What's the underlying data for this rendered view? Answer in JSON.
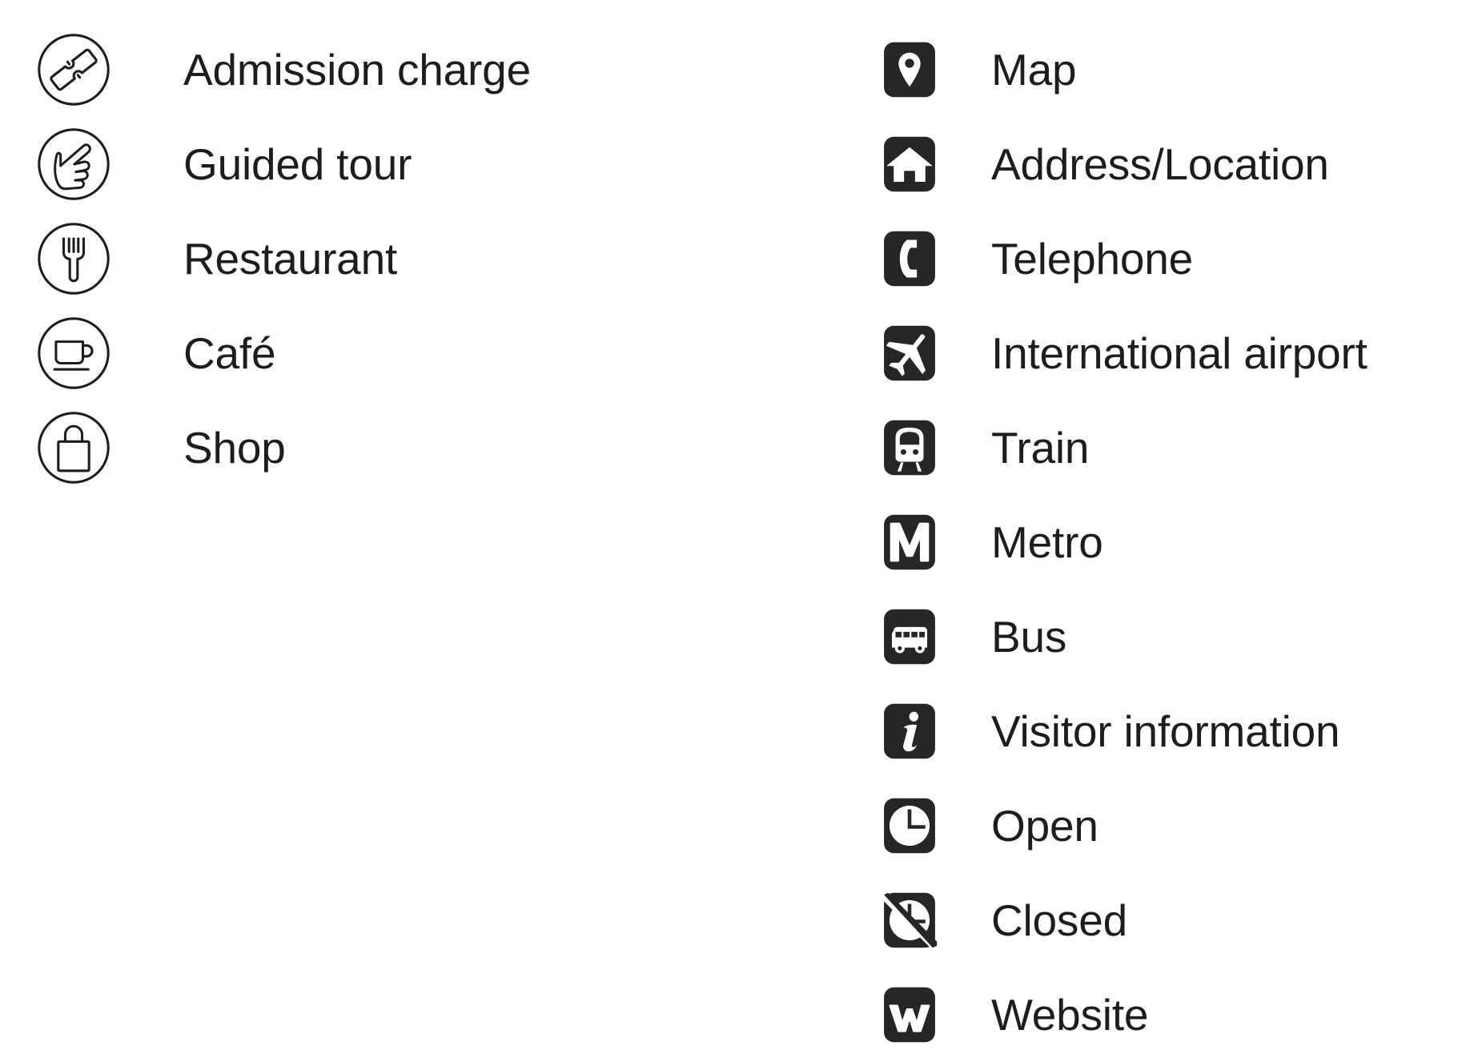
{
  "page": {
    "background_color": "#ffffff",
    "text_color": "#1d1d1b",
    "icon_fill_color": "#262626"
  },
  "legend": {
    "columns": [
      {
        "id": "facilities",
        "icon_style": "outline-circle",
        "items": [
          {
            "label": "Admission charge",
            "icon": "ticket-icon"
          },
          {
            "label": "Guided tour",
            "icon": "pointing-hand-icon"
          },
          {
            "label": "Restaurant",
            "icon": "fork-icon"
          },
          {
            "label": "Café",
            "icon": "coffee-cup-icon"
          },
          {
            "label": "Shop",
            "icon": "shopping-bag-icon"
          }
        ]
      },
      {
        "id": "practical-information",
        "icon_style": "solid-rounded-square",
        "items": [
          {
            "label": "Map",
            "icon": "map-pin-icon"
          },
          {
            "label": "Address/Location",
            "icon": "house-icon"
          },
          {
            "label": "Telephone",
            "icon": "telephone-icon"
          },
          {
            "label": "International airport",
            "icon": "airplane-icon"
          },
          {
            "label": "Train",
            "icon": "train-icon"
          },
          {
            "label": "Metro",
            "icon": "metro-m-icon"
          },
          {
            "label": "Bus",
            "icon": "bus-icon"
          },
          {
            "label": "Visitor information",
            "icon": "information-i-icon"
          },
          {
            "label": "Open",
            "icon": "clock-open-icon"
          },
          {
            "label": "Closed",
            "icon": "clock-closed-icon"
          },
          {
            "label": "Website",
            "icon": "website-w-icon"
          }
        ]
      }
    ]
  }
}
